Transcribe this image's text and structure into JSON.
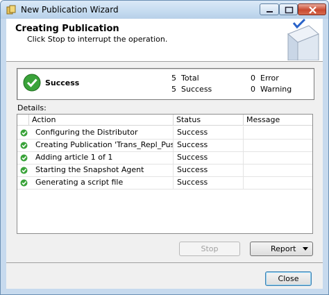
{
  "window": {
    "title": "New Publication Wizard"
  },
  "header": {
    "title": "Creating Publication",
    "subtitle": "Click Stop to interrupt the operation."
  },
  "summary": {
    "status": "Success",
    "counts": [
      {
        "value": "5",
        "label": "Total"
      },
      {
        "value": "5",
        "label": "Success"
      },
      {
        "value": "0",
        "label": "Error"
      },
      {
        "value": "0",
        "label": "Warning"
      }
    ]
  },
  "details": {
    "label": "Details:",
    "columns": [
      "Action",
      "Status",
      "Message"
    ],
    "rows": [
      {
        "action": "Configuring the Distributor",
        "status": "Success",
        "message": ""
      },
      {
        "action": "Creating Publication 'Trans_Repl_Push_...",
        "status": "Success",
        "message": ""
      },
      {
        "action": "Adding article 1 of 1",
        "status": "Success",
        "message": ""
      },
      {
        "action": "Starting the Snapshot Agent",
        "status": "Success",
        "message": ""
      },
      {
        "action": "Generating a script file",
        "status": "Success",
        "message": ""
      }
    ]
  },
  "buttons": {
    "stop": "Stop",
    "report": "Report",
    "close": "Close"
  },
  "colors": {
    "success": "#3aa33a",
    "title_bar": "#c5dbf0"
  }
}
